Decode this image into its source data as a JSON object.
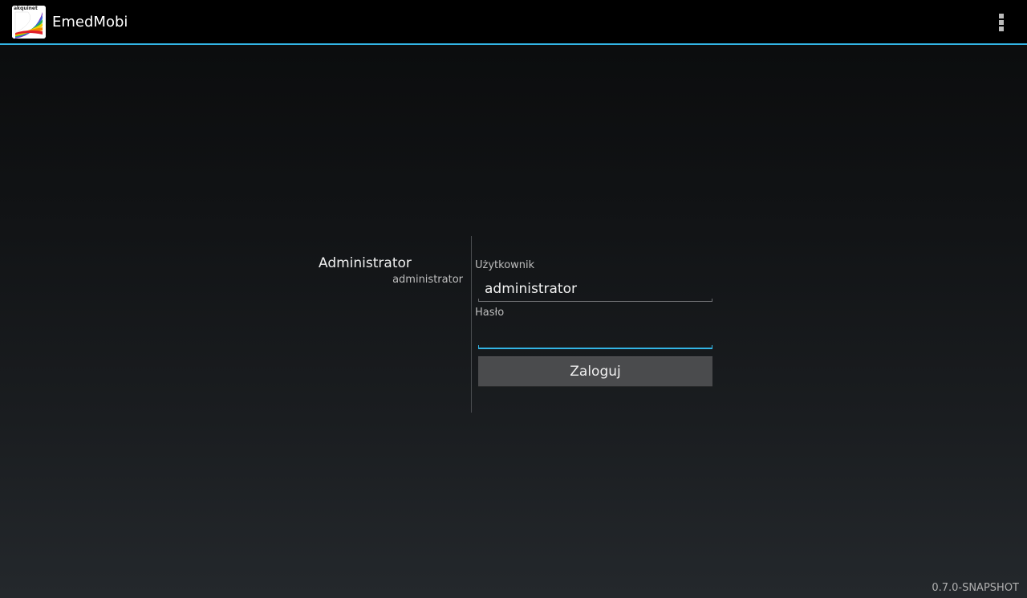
{
  "action_bar": {
    "title": "EmedMobi",
    "logo_text": "akquinet",
    "overflow_icon": "overflow-menu-icon"
  },
  "account": {
    "display_name": "Administrator",
    "login": "administrator"
  },
  "form": {
    "username_label": "Użytkownik",
    "username_value": "administrator",
    "password_label": "Hasło",
    "password_value": "",
    "login_button": "Zaloguj"
  },
  "footer": {
    "version": "0.7.0-SNAPSHOT"
  },
  "colors": {
    "accent": "#33b5e5",
    "action_bar_bg": "#000000",
    "button_bg": "#4a4b4d"
  }
}
